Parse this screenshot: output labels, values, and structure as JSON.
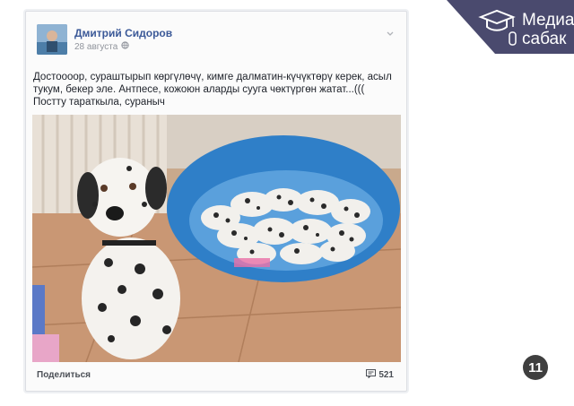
{
  "post": {
    "author": "Дмитрий Сидоров",
    "date": "28 августа",
    "text_line1": "Достоооор, сураштырып көргүлөчү, кимге далматин-күчүктөрү керек, асыл",
    "text_line2": "тукум,  бекер эле.  Антпесе, кожоюн аларды сууга чөктүргөн жатат...(((",
    "text_line3": "Постту тараткыла, сураныч",
    "share_label": "Поделиться",
    "comment_count": "521"
  },
  "brand": {
    "line1": "Медиа",
    "line2": "сабак",
    "color": "#4a4a6e"
  },
  "slide_number": "11"
}
